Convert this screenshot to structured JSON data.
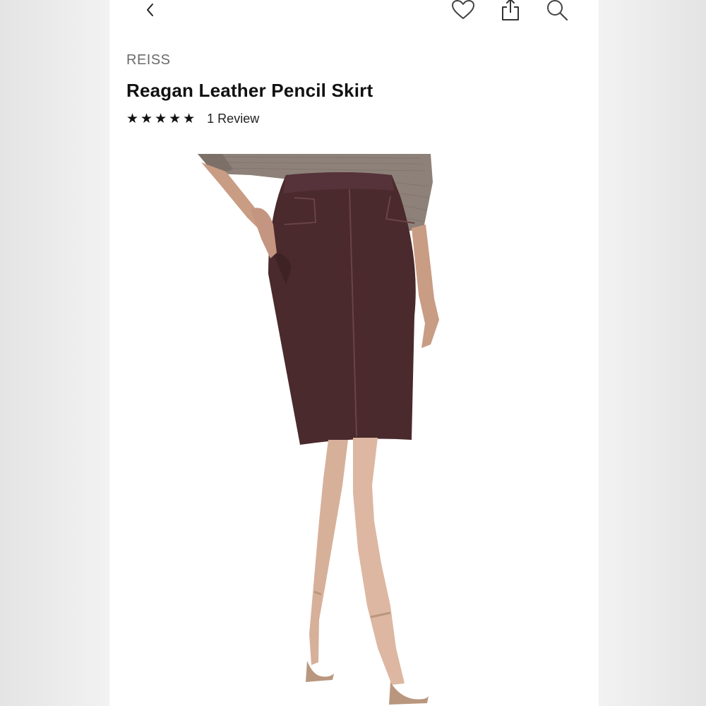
{
  "product": {
    "brand": "REISS",
    "title": "Reagan Leather Pencil Skirt",
    "rating_stars": "★★★★★",
    "rating_value": 5,
    "rating_max": 5,
    "review_count_label": "1 Review"
  },
  "icons": {
    "back": "chevron-left-icon",
    "favorite": "heart-icon",
    "share": "share-icon",
    "search": "search-icon"
  },
  "colors": {
    "skirt": "#4a2a2c",
    "sweater": "#8d8179",
    "text": "#111111",
    "brand_text": "#6b6b6b"
  }
}
